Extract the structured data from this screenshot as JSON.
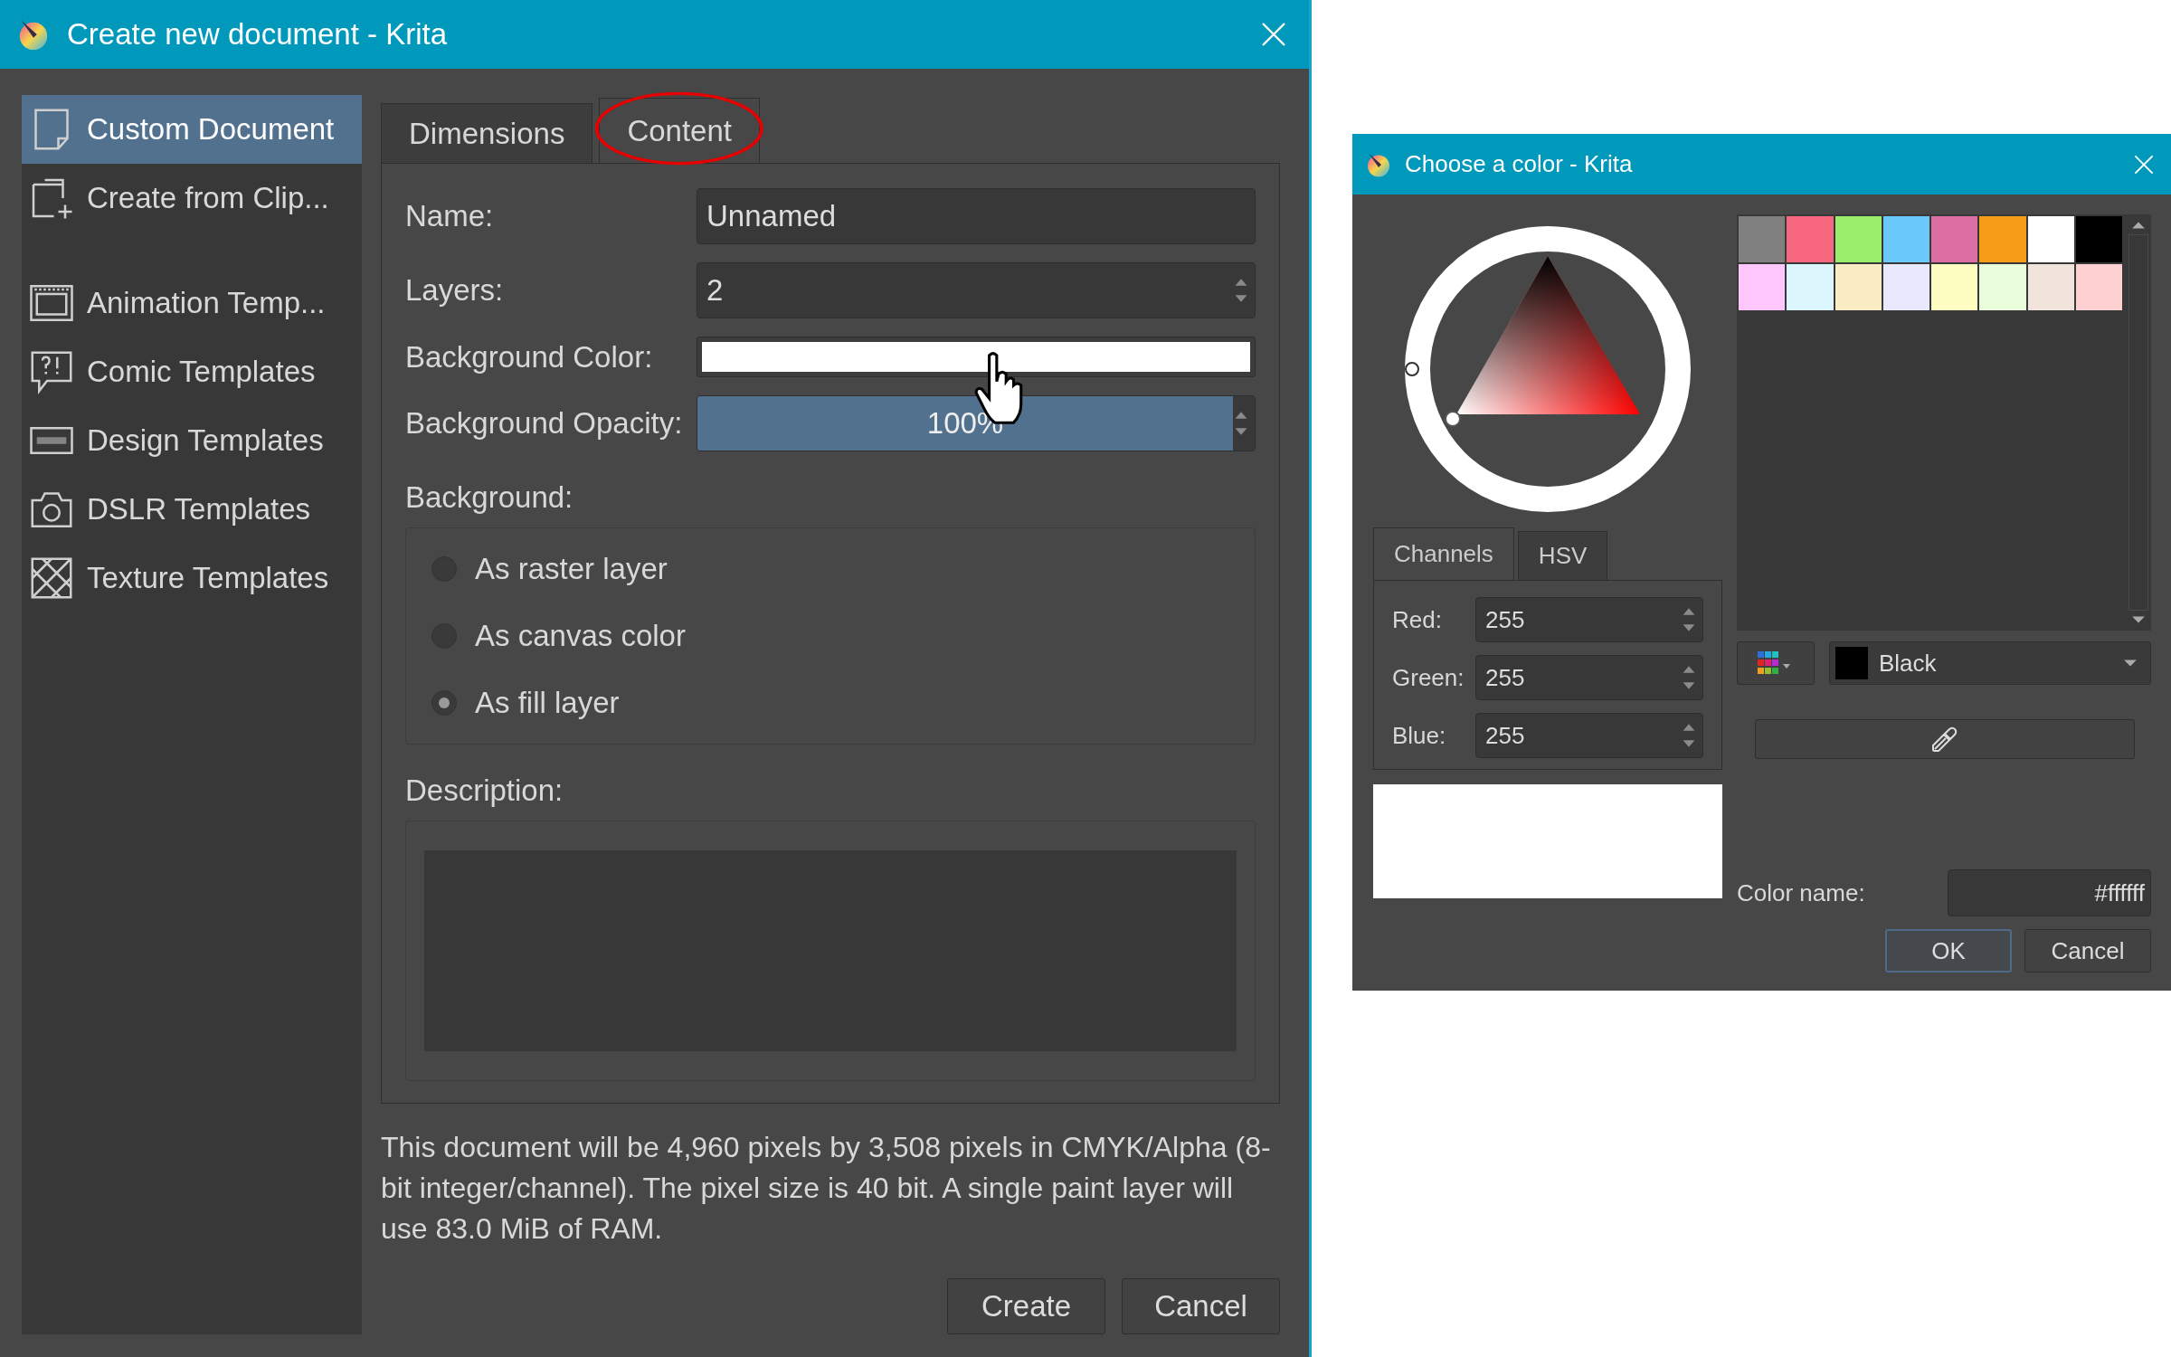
{
  "main_dialog": {
    "title": "Create new document - Krita",
    "sidebar": {
      "sections": [
        {
          "items": [
            {
              "label": "Custom Document",
              "kind": "page",
              "selected": true
            },
            {
              "label": "Create from Clip...",
              "kind": "clipboard",
              "selected": false
            }
          ]
        },
        {
          "items": [
            {
              "label": "Animation Temp...",
              "kind": "film",
              "selected": false
            },
            {
              "label": "Comic Templates",
              "kind": "speech",
              "selected": false
            },
            {
              "label": "Design Templates",
              "kind": "ratio",
              "selected": false
            },
            {
              "label": "DSLR Templates",
              "kind": "camera",
              "selected": false
            },
            {
              "label": "Texture Templates",
              "kind": "texture",
              "selected": false
            }
          ]
        }
      ]
    },
    "tabs": [
      {
        "label": "Dimensions",
        "selected": false,
        "circled": false
      },
      {
        "label": "Content",
        "selected": true,
        "circled": true
      }
    ],
    "fields": [
      {
        "kind": "text",
        "label": "Name:",
        "value": "Unnamed"
      },
      {
        "kind": "spin",
        "label": "Layers:",
        "value": "2"
      },
      {
        "kind": "color",
        "label": "Background Color:",
        "color": "#ffffff"
      },
      {
        "kind": "slider",
        "label": "Background Opacity:",
        "level": 1.0,
        "reading": "100%"
      }
    ],
    "background": {
      "label": "Background:",
      "options": [
        {
          "label": "As raster layer",
          "selected": false
        },
        {
          "label": "As canvas color",
          "selected": false
        },
        {
          "label": "As fill layer",
          "selected": true
        }
      ]
    },
    "description": {
      "label": "Description:"
    },
    "info": "This document will be 4,960 pixels by 3,508 pixels in CMYK/Alpha (8-bit integer/channel). The pixel size is 40 bit. A single paint layer will use 83.0 MiB of RAM.",
    "buttons": [
      "Create",
      "Cancel"
    ]
  },
  "color_dialog": {
    "title": "Choose a color - Krita",
    "swatches": [
      {
        "color": "#808080"
      },
      {
        "color": "#f7677f"
      },
      {
        "color": "#99ee6b"
      },
      {
        "color": "#6ac8fb"
      },
      {
        "color": "#dd6ea4"
      },
      {
        "color": "#f59c18"
      },
      {
        "color": "#ffffff"
      },
      {
        "color": "#000000"
      },
      {
        "color": "#fec6fd"
      },
      {
        "color": "#dbf7fd"
      },
      {
        "color": "#fcecc5"
      },
      {
        "color": "#e9e9fd"
      },
      {
        "color": "#fefec2"
      },
      {
        "color": "#e9fcdb"
      },
      {
        "color": "#f0e4dd"
      },
      {
        "color": "#fdd1d1"
      }
    ],
    "tabs": [
      {
        "label": "Channels",
        "selected": true
      },
      {
        "label": "HSV",
        "selected": false
      }
    ],
    "channels": [
      {
        "label": "Red:",
        "value": "255"
      },
      {
        "label": "Green:",
        "value": "255"
      },
      {
        "label": "Blue:",
        "value": "255"
      }
    ],
    "preview": {
      "color": "#ffffff"
    },
    "palette": {
      "label": "Black",
      "color": "#000000"
    },
    "color_name": {
      "label": "Color name:",
      "value": "#ffffff"
    },
    "buttons": [
      {
        "label": "OK",
        "default": true
      },
      {
        "label": "Cancel",
        "default": false
      }
    ]
  }
}
